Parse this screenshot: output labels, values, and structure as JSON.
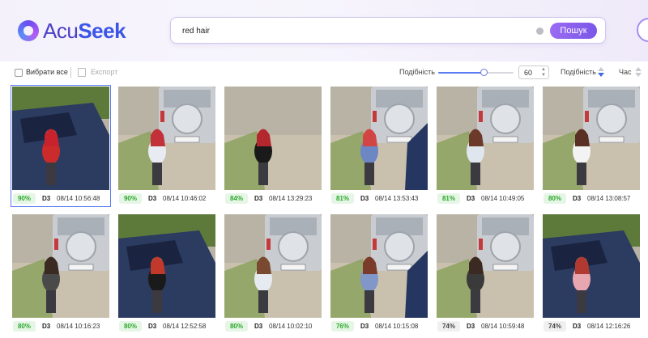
{
  "app": {
    "logo_text_a": "Acu",
    "logo_text_b": "Seek",
    "brand_color": "#4b3fc9",
    "accent": "#7a56e8"
  },
  "search": {
    "query": "red hair",
    "button_label": "Пошук"
  },
  "toolbar": {
    "select_all": "Вибрати все",
    "export": "Експорт",
    "similarity_label": "Подібність",
    "similarity_value": "60",
    "similarity_fraction": 0.6,
    "sort_similarity": "Подібність",
    "sort_time": "Час"
  },
  "results": [
    {
      "score": "90%",
      "camera": "D3",
      "time": "08/14 10:56:48",
      "scene": "car-dark",
      "selected": true,
      "hair": "#c8232c",
      "shirt": "#cc2b2b"
    },
    {
      "score": "90%",
      "camera": "D3",
      "time": "08/14 10:46:02",
      "scene": "jeep",
      "selected": false,
      "hair": "#c2303a",
      "shirt": "#e8ecf2"
    },
    {
      "score": "84%",
      "camera": "D3",
      "time": "08/14 13:29:23",
      "scene": "ground",
      "selected": false,
      "hair": "#b3272f",
      "shirt": "#1a1a1a"
    },
    {
      "score": "81%",
      "camera": "D3",
      "time": "08/14 13:53:43",
      "scene": "jeep-car",
      "selected": false,
      "hair": "#d24545",
      "shirt": "#6d86c4"
    },
    {
      "score": "81%",
      "camera": "D3",
      "time": "08/14 10:49:05",
      "scene": "jeep",
      "selected": false,
      "hair": "#6b3a2a",
      "shirt": "#dfe6ee"
    },
    {
      "score": "80%",
      "camera": "D3",
      "time": "08/14 13:08:57",
      "scene": "jeep",
      "selected": false,
      "hair": "#5a2f24",
      "shirt": "#f3f3f3"
    },
    {
      "score": "80%",
      "camera": "D3",
      "time": "08/14 10:16:23",
      "scene": "jeep",
      "selected": false,
      "hair": "#3a2a22",
      "shirt": "#4a4a4a"
    },
    {
      "score": "80%",
      "camera": "D3",
      "time": "08/14 12:52:58",
      "scene": "car-dark",
      "selected": false,
      "hair": "#c0392b",
      "shirt": "#1a1a1a"
    },
    {
      "score": "80%",
      "camera": "D3",
      "time": "08/14 10:02:10",
      "scene": "jeep",
      "selected": false,
      "hair": "#7a4a30",
      "shirt": "#e6ebf2"
    },
    {
      "score": "76%",
      "camera": "D3",
      "time": "08/14 10:15:08",
      "scene": "jeep-car",
      "selected": false,
      "hair": "#7a3b2a",
      "shirt": "#8196c9"
    },
    {
      "score": "74%",
      "camera": "D3",
      "time": "08/14 10:59:48",
      "scene": "jeep",
      "selected": false,
      "hair": "#3b2a22",
      "shirt": "#3a3a3a"
    },
    {
      "score": "74%",
      "camera": "D3",
      "time": "08/14 12:16:26",
      "scene": "car-dark",
      "selected": false,
      "hair": "#b03a32",
      "shirt": "#e8a6b0"
    }
  ]
}
